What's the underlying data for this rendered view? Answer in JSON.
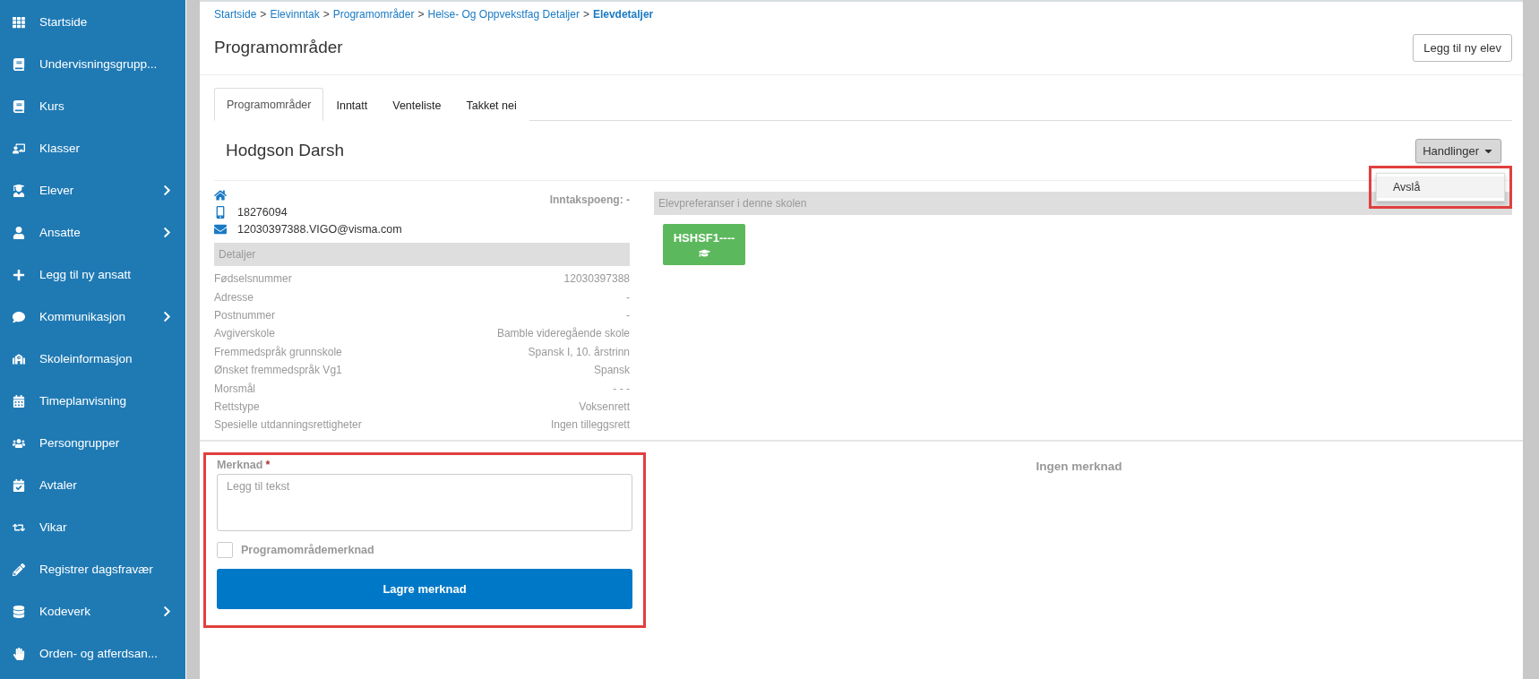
{
  "sidebar": {
    "items": [
      {
        "label": "Startside",
        "has_submenu": false
      },
      {
        "label": "Undervisningsgrupp...",
        "has_submenu": false
      },
      {
        "label": "Kurs",
        "has_submenu": false
      },
      {
        "label": "Klasser",
        "has_submenu": false
      },
      {
        "label": "Elever",
        "has_submenu": true
      },
      {
        "label": "Ansatte",
        "has_submenu": true
      },
      {
        "label": "Legg til ny ansatt",
        "has_submenu": false
      },
      {
        "label": "Kommunikasjon",
        "has_submenu": true
      },
      {
        "label": "Skoleinformasjon",
        "has_submenu": false
      },
      {
        "label": "Timeplanvisning",
        "has_submenu": false
      },
      {
        "label": "Persongrupper",
        "has_submenu": false
      },
      {
        "label": "Avtaler",
        "has_submenu": false
      },
      {
        "label": "Vikar",
        "has_submenu": false
      },
      {
        "label": "Registrer dagsfravær",
        "has_submenu": false
      },
      {
        "label": "Kodeverk",
        "has_submenu": true
      },
      {
        "label": "Orden- og atferdsan...",
        "has_submenu": false
      }
    ]
  },
  "breadcrumb": [
    {
      "label": "Startside",
      "current": false
    },
    {
      "label": "Elevinntak",
      "current": false
    },
    {
      "label": "Programområder",
      "current": false
    },
    {
      "label": "Helse- Og Oppvekstfag Detaljer",
      "current": false
    },
    {
      "label": "Elevdetaljer",
      "current": true
    }
  ],
  "breadcrumb_separator": ">",
  "page_title": "Programområder",
  "add_button": "Legg til ny elev",
  "tabs": [
    {
      "label": "Programområder",
      "selected": true
    },
    {
      "label": "Inntatt",
      "selected": false
    },
    {
      "label": "Venteliste",
      "selected": false
    },
    {
      "label": "Takket nei",
      "selected": false
    }
  ],
  "student": {
    "name": "Hodgson Darsh",
    "phone": "18276094",
    "email": "12030397388.VIGO@visma.com",
    "score": "Inntakspoeng: -"
  },
  "actions": {
    "label": "Handlinger",
    "expanded": true,
    "menu": [
      {
        "label": "Avslå"
      }
    ],
    "highlighted": true
  },
  "details": {
    "title": "Detaljer",
    "rows": [
      {
        "label": "Fødselsnummer",
        "value": "12030397388"
      },
      {
        "label": "Adresse",
        "value": "-"
      },
      {
        "label": "Postnummer",
        "value": "-"
      },
      {
        "label": "Avgiverskole",
        "value": "Bamble videregående skole"
      },
      {
        "label": "Fremmedspråk grunnskole",
        "value": "Spansk I, 10. årstrinn"
      },
      {
        "label": "Ønsket fremmedspråk Vg1",
        "value": "Spansk"
      },
      {
        "label": "Morsmål",
        "value": "- - -"
      },
      {
        "label": "Rettstype",
        "value": "Voksenrett"
      },
      {
        "label": "Spesielle utdanningsrettigheter",
        "value": "Ingen tilleggsrett"
      }
    ]
  },
  "preferences": {
    "title": "Elevpreferanser i denne skolen",
    "items": [
      {
        "code": "HSHSF1----"
      }
    ]
  },
  "note_form": {
    "label": "Merknad",
    "required_mark": "*",
    "placeholder": "Legg til tekst",
    "checkbox": {
      "label": "Programområdemerknad",
      "checked": false
    },
    "submit": "Lagre merknad",
    "highlighted": true
  },
  "notes_empty": "Ingen merknad"
}
